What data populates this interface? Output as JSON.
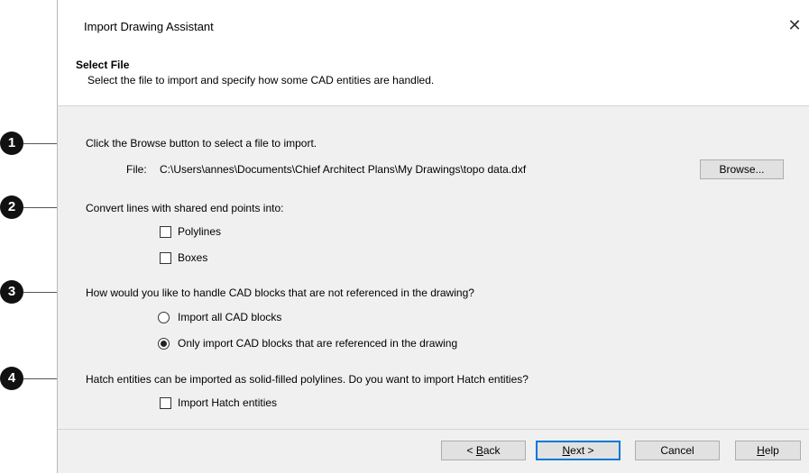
{
  "dialog": {
    "title": "Import Drawing Assistant",
    "close_glyph": "✕"
  },
  "header": {
    "title": "Select File",
    "subtitle": "Select the file to import and specify how some CAD entities are handled."
  },
  "sections": {
    "file": {
      "instruction": "Click the Browse button to select a file to import.",
      "file_label": "File:",
      "file_path": "C:\\Users\\annes\\Documents\\Chief Architect Plans\\My Drawings\\topo data.dxf",
      "browse_label": "Browse..."
    },
    "lines": {
      "instruction": "Convert lines with shared end points into:",
      "polylines_label": "Polylines",
      "polylines_checked": false,
      "boxes_label": "Boxes",
      "boxes_checked": false
    },
    "blocks": {
      "instruction": "How would you like to handle CAD blocks that are not referenced in the drawing?",
      "import_all_label": "Import all CAD blocks",
      "only_referenced_label": "Only import CAD blocks that are referenced in the drawing",
      "selected": "only_referenced"
    },
    "hatch": {
      "instruction": "Hatch entities can be imported as solid-filled polylines. Do you want to import Hatch entities?",
      "import_hatch_label": "Import Hatch entities",
      "import_hatch_checked": false
    }
  },
  "footer": {
    "back_prefix": "< ",
    "back_mnemonic": "B",
    "back_rest": "ack",
    "next_mnemonic": "N",
    "next_rest": "ext >",
    "cancel_label": "Cancel",
    "help_mnemonic": "H",
    "help_rest": "elp"
  },
  "callouts": [
    "1",
    "2",
    "3",
    "4"
  ]
}
